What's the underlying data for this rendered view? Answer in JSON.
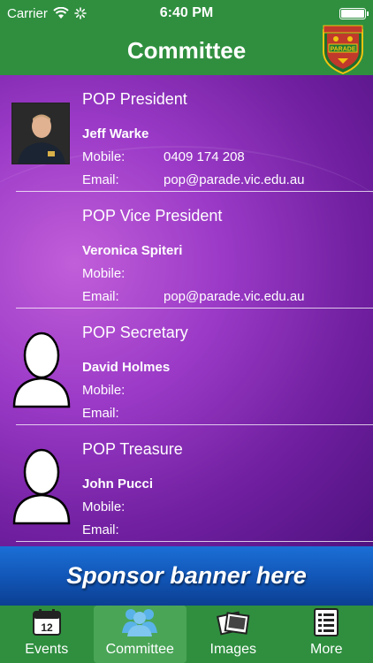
{
  "status_bar": {
    "carrier": "Carrier",
    "time": "6:40 PM"
  },
  "nav": {
    "title": "Committee",
    "crest_text": "PARADE"
  },
  "members": [
    {
      "role": "POP President",
      "name": "Jeff Warke",
      "mobile_label": "Mobile:",
      "mobile": "0409 174 208",
      "email_label": "Email:",
      "email": "pop@parade.vic.edu.au",
      "has_photo": true
    },
    {
      "role": "POP Vice President",
      "name": "Veronica Spiteri",
      "mobile_label": "Mobile:",
      "mobile": "",
      "email_label": "Email:",
      "email": "pop@parade.vic.edu.au",
      "has_photo": false
    },
    {
      "role": "POP Secretary",
      "name": "David Holmes",
      "mobile_label": "Mobile:",
      "mobile": "",
      "email_label": "Email:",
      "email": "",
      "has_photo": false
    },
    {
      "role": "POP Treasure",
      "name": "John Pucci",
      "mobile_label": "Mobile:",
      "mobile": "",
      "email_label": "Email:",
      "email": "",
      "has_photo": false
    }
  ],
  "banner": {
    "text": "Sponsor banner here"
  },
  "tabs": [
    {
      "label": "Events",
      "icon": "calendar-icon",
      "active": false,
      "calendar_day": "12"
    },
    {
      "label": "Committee",
      "icon": "people-icon",
      "active": true
    },
    {
      "label": "Images",
      "icon": "photos-icon",
      "active": false
    },
    {
      "label": "More",
      "icon": "list-icon",
      "active": false
    }
  ],
  "colors": {
    "bar_green": "#2f8f3f",
    "active_tab": "#4aa557",
    "content_purple": "#9b3ac7",
    "banner_blue": "#1257b8"
  }
}
